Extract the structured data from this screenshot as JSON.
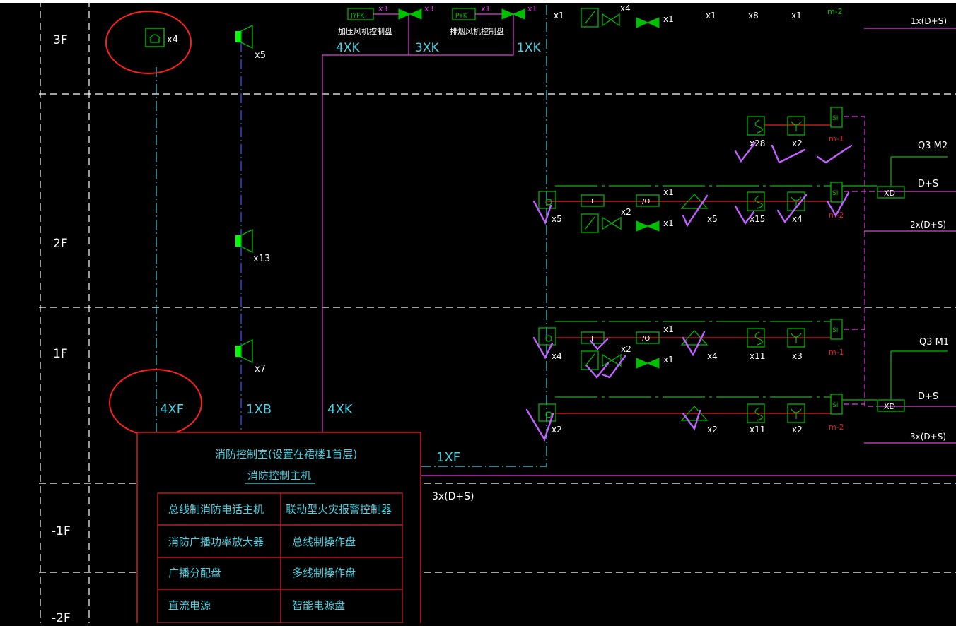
{
  "colors": {
    "background": "#000000",
    "grid": "#ffffff",
    "cyan": "#4dd0e1",
    "blue": "#3b5bff",
    "magenta": "#e040e0",
    "green": "#00c000",
    "bright_green": "#00ff00",
    "red": "#e02020",
    "check_marks": "#c060ff",
    "highlight_circle": "#ff2020"
  },
  "floors": {
    "f3": "3F",
    "f2": "2F",
    "f1": "1F",
    "b1": "-1F",
    "b2": "-2F"
  },
  "top_labels": {
    "jyfk": "JYFK",
    "pyk": "PYK",
    "x3a": "x3",
    "x3b": "x3",
    "x1a": "x1",
    "x1b": "x1",
    "jiaya": "加压风机控制盘",
    "paiyan": "排烟风机控制盘",
    "xk4": "4XK",
    "xk3": "3XK",
    "xk1": "1XK",
    "x1c": "x1",
    "x4top": "x4",
    "x1d": "x1",
    "x1e": "x1",
    "x8": "x8",
    "x1f": "x1",
    "m2top": "m-2",
    "ds1": "1x(D+S)"
  },
  "left_labels": {
    "x4_phone": "x4",
    "x5_spk": "x5",
    "x13_spk": "x13",
    "x7_spk": "x7",
    "xf4": "4XF",
    "xb1": "1XB",
    "xk4b": "4XK",
    "xf1": "1XF",
    "ds3": "3x(D+S)"
  },
  "zone2_upper": {
    "x28": "x28",
    "x2": "x2",
    "m1": "m-1",
    "si": "SI",
    "q3m2": "Q3 M2",
    "ds": "D+S",
    "xd": "XD",
    "ds2": "2x(D+S)"
  },
  "zone2_lower": {
    "x5": "x5",
    "i": "I",
    "x2": "x2",
    "io": "I/O",
    "x1a": "x1",
    "x1b": "x1",
    "x5b": "x5",
    "x15": "x15",
    "x4": "x4",
    "m2": "m-2",
    "si": "SI"
  },
  "zone1_upper": {
    "x4a": "x4",
    "i": "I",
    "x2": "x2",
    "io": "I/O",
    "x1a": "x1",
    "x1b": "x1",
    "x4b": "x4",
    "x11": "x11",
    "x3": "x3",
    "m1": "m-1",
    "si": "SI",
    "q3m1": "Q3 M1",
    "ds": "D+S",
    "xd": "XD"
  },
  "zone1_lower": {
    "x2a": "x2",
    "x2b": "x2",
    "x11": "x11",
    "x2c": "x2",
    "m2": "m-2",
    "si": "SI",
    "ds3": "3x(D+S)"
  },
  "control_room": {
    "title": "消防控制室(设置在裙楼1首层)",
    "subtitle": "消防控制主机",
    "table": [
      [
        "总线制消防电话主机",
        "联动型火灾报警控制器"
      ],
      [
        "消防广播功率放大器",
        "总线制操作盘"
      ],
      [
        "广播分配盘",
        "多线制操作盘"
      ],
      [
        "直流电源",
        "智能电源盘"
      ]
    ]
  }
}
